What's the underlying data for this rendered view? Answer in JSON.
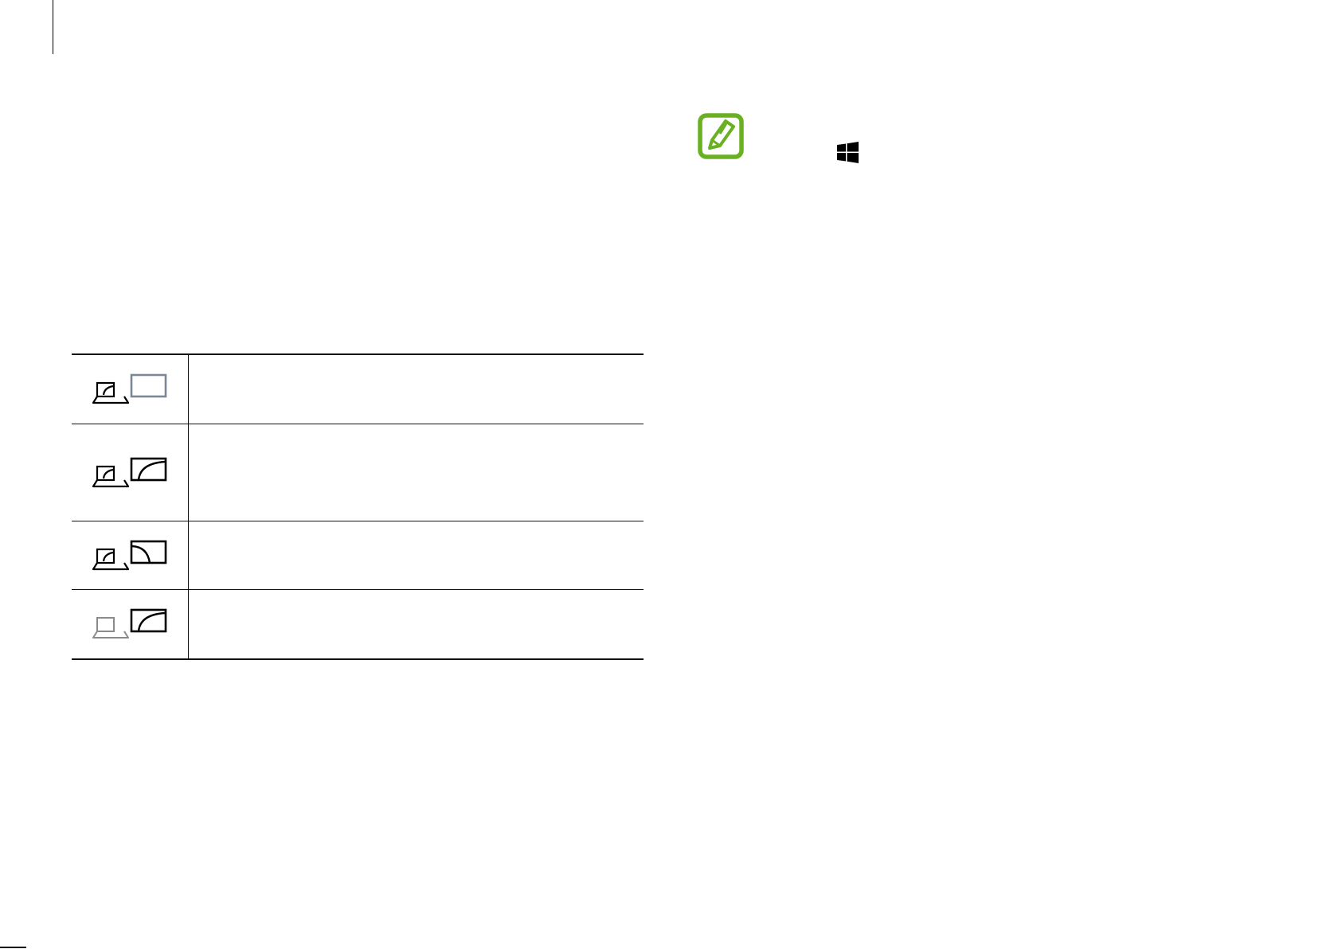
{
  "display_modes": [
    {
      "icon": "pc-screen-only-icon",
      "description": ""
    },
    {
      "icon": "duplicate-icon",
      "description": ""
    },
    {
      "icon": "extend-icon",
      "description": ""
    },
    {
      "icon": "second-screen-only-icon",
      "description": ""
    }
  ],
  "note": {
    "icon": "note-pencil-icon",
    "inline_icon": "windows-start-icon",
    "text": ""
  },
  "colors": {
    "note_green": "#6ab023",
    "rule": "#111111",
    "inactive_gray": "#8a8a8a",
    "blue_gray": "#7b8794"
  },
  "footer": {
    "text": ""
  }
}
